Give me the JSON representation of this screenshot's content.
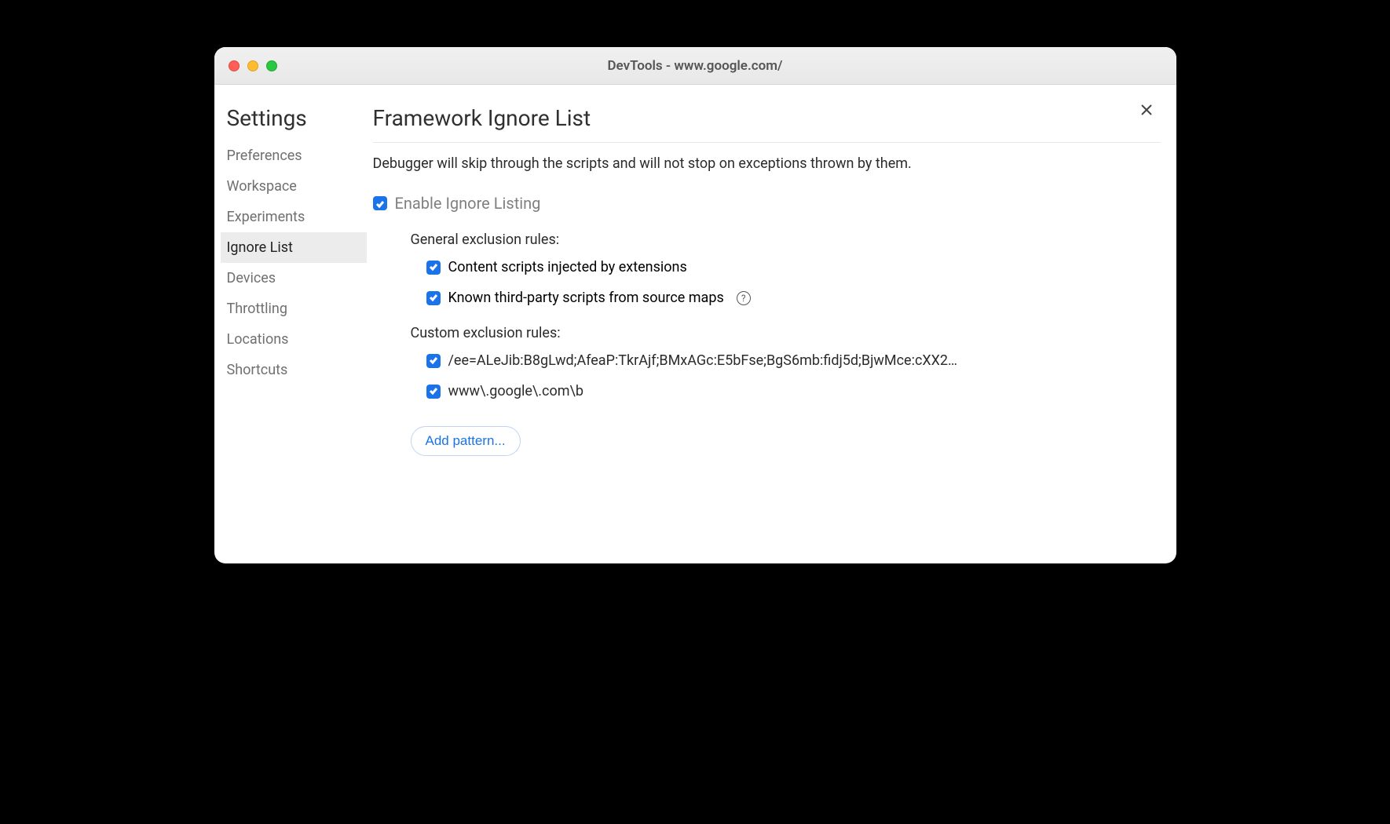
{
  "window": {
    "title": "DevTools - www.google.com/"
  },
  "sidebar": {
    "title": "Settings",
    "items": [
      {
        "label": "Preferences",
        "active": false
      },
      {
        "label": "Workspace",
        "active": false
      },
      {
        "label": "Experiments",
        "active": false
      },
      {
        "label": "Ignore List",
        "active": true
      },
      {
        "label": "Devices",
        "active": false
      },
      {
        "label": "Throttling",
        "active": false
      },
      {
        "label": "Locations",
        "active": false
      },
      {
        "label": "Shortcuts",
        "active": false
      }
    ]
  },
  "page": {
    "title": "Framework Ignore List",
    "description": "Debugger will skip through the scripts and will not stop on exceptions thrown by them.",
    "enable_label": "Enable Ignore Listing",
    "enable_checked": true,
    "general_rules": {
      "heading": "General exclusion rules:",
      "items": [
        {
          "label": "Content scripts injected by extensions",
          "checked": true,
          "help": false
        },
        {
          "label": "Known third-party scripts from source maps",
          "checked": true,
          "help": true
        }
      ]
    },
    "custom_rules": {
      "heading": "Custom exclusion rules:",
      "items": [
        {
          "label": "/ee=ALeJib:B8gLwd;AfeaP:TkrAjf;BMxAGc:E5bFse;BgS6mb:fidj5d;BjwMce:cXX2…",
          "checked": true
        },
        {
          "label": "www\\.google\\.com\\b",
          "checked": true
        }
      ]
    },
    "add_pattern_label": "Add pattern..."
  }
}
